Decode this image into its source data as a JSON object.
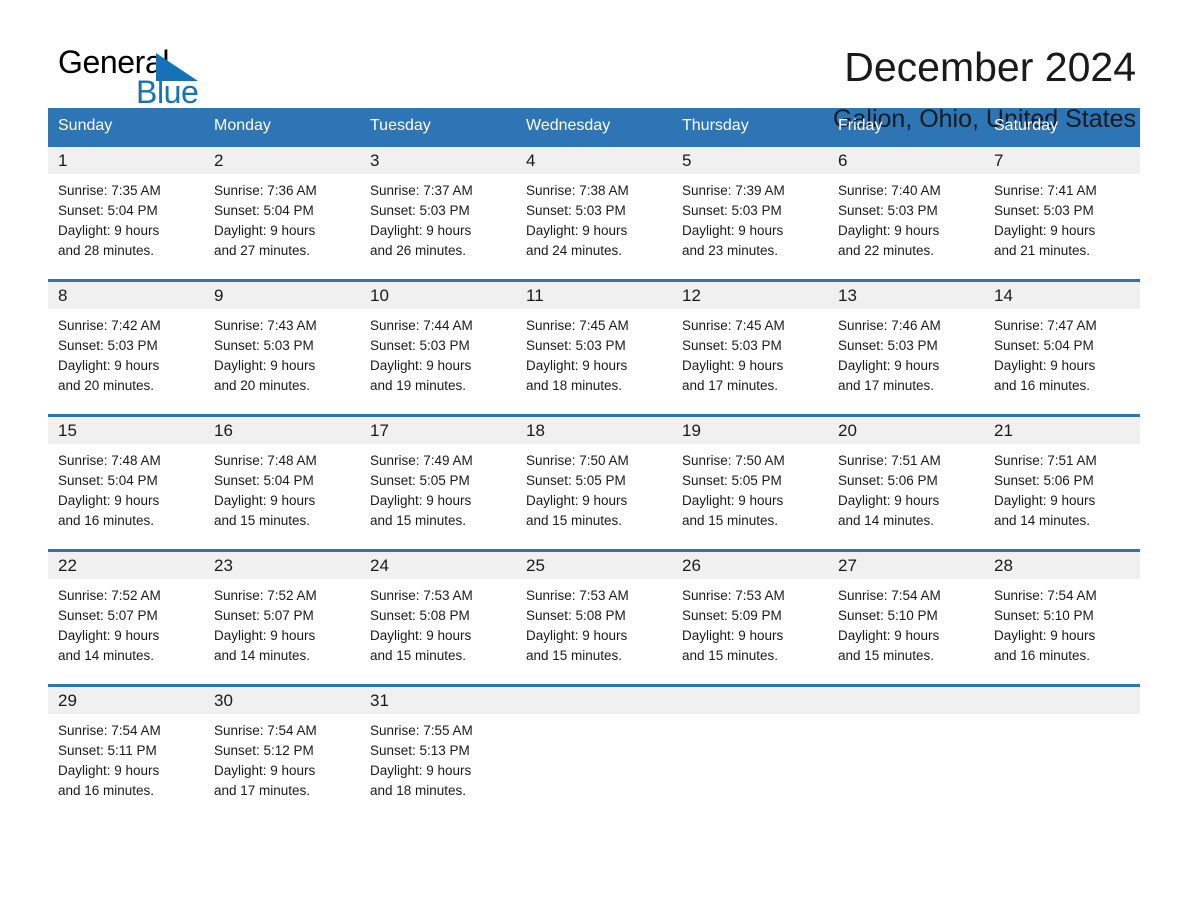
{
  "brand": {
    "name_part1": "General",
    "name_part2": "Blue",
    "triangle_icon": "blue-triangle-icon",
    "accent_color": "#1572b8"
  },
  "header": {
    "title": "December 2024",
    "location": "Galion, Ohio, United States",
    "header_bg_color": "#2e75b6",
    "daynum_bg_color": "#f0f0f0"
  },
  "weekday_headers": [
    "Sunday",
    "Monday",
    "Tuesday",
    "Wednesday",
    "Thursday",
    "Friday",
    "Saturday"
  ],
  "weeks": [
    [
      {
        "day": "1",
        "sunrise": "Sunrise: 7:35 AM",
        "sunset": "Sunset: 5:04 PM",
        "daylight_line1": "Daylight: 9 hours",
        "daylight_line2": "and 28 minutes."
      },
      {
        "day": "2",
        "sunrise": "Sunrise: 7:36 AM",
        "sunset": "Sunset: 5:04 PM",
        "daylight_line1": "Daylight: 9 hours",
        "daylight_line2": "and 27 minutes."
      },
      {
        "day": "3",
        "sunrise": "Sunrise: 7:37 AM",
        "sunset": "Sunset: 5:03 PM",
        "daylight_line1": "Daylight: 9 hours",
        "daylight_line2": "and 26 minutes."
      },
      {
        "day": "4",
        "sunrise": "Sunrise: 7:38 AM",
        "sunset": "Sunset: 5:03 PM",
        "daylight_line1": "Daylight: 9 hours",
        "daylight_line2": "and 24 minutes."
      },
      {
        "day": "5",
        "sunrise": "Sunrise: 7:39 AM",
        "sunset": "Sunset: 5:03 PM",
        "daylight_line1": "Daylight: 9 hours",
        "daylight_line2": "and 23 minutes."
      },
      {
        "day": "6",
        "sunrise": "Sunrise: 7:40 AM",
        "sunset": "Sunset: 5:03 PM",
        "daylight_line1": "Daylight: 9 hours",
        "daylight_line2": "and 22 minutes."
      },
      {
        "day": "7",
        "sunrise": "Sunrise: 7:41 AM",
        "sunset": "Sunset: 5:03 PM",
        "daylight_line1": "Daylight: 9 hours",
        "daylight_line2": "and 21 minutes."
      }
    ],
    [
      {
        "day": "8",
        "sunrise": "Sunrise: 7:42 AM",
        "sunset": "Sunset: 5:03 PM",
        "daylight_line1": "Daylight: 9 hours",
        "daylight_line2": "and 20 minutes."
      },
      {
        "day": "9",
        "sunrise": "Sunrise: 7:43 AM",
        "sunset": "Sunset: 5:03 PM",
        "daylight_line1": "Daylight: 9 hours",
        "daylight_line2": "and 20 minutes."
      },
      {
        "day": "10",
        "sunrise": "Sunrise: 7:44 AM",
        "sunset": "Sunset: 5:03 PM",
        "daylight_line1": "Daylight: 9 hours",
        "daylight_line2": "and 19 minutes."
      },
      {
        "day": "11",
        "sunrise": "Sunrise: 7:45 AM",
        "sunset": "Sunset: 5:03 PM",
        "daylight_line1": "Daylight: 9 hours",
        "daylight_line2": "and 18 minutes."
      },
      {
        "day": "12",
        "sunrise": "Sunrise: 7:45 AM",
        "sunset": "Sunset: 5:03 PM",
        "daylight_line1": "Daylight: 9 hours",
        "daylight_line2": "and 17 minutes."
      },
      {
        "day": "13",
        "sunrise": "Sunrise: 7:46 AM",
        "sunset": "Sunset: 5:03 PM",
        "daylight_line1": "Daylight: 9 hours",
        "daylight_line2": "and 17 minutes."
      },
      {
        "day": "14",
        "sunrise": "Sunrise: 7:47 AM",
        "sunset": "Sunset: 5:04 PM",
        "daylight_line1": "Daylight: 9 hours",
        "daylight_line2": "and 16 minutes."
      }
    ],
    [
      {
        "day": "15",
        "sunrise": "Sunrise: 7:48 AM",
        "sunset": "Sunset: 5:04 PM",
        "daylight_line1": "Daylight: 9 hours",
        "daylight_line2": "and 16 minutes."
      },
      {
        "day": "16",
        "sunrise": "Sunrise: 7:48 AM",
        "sunset": "Sunset: 5:04 PM",
        "daylight_line1": "Daylight: 9 hours",
        "daylight_line2": "and 15 minutes."
      },
      {
        "day": "17",
        "sunrise": "Sunrise: 7:49 AM",
        "sunset": "Sunset: 5:05 PM",
        "daylight_line1": "Daylight: 9 hours",
        "daylight_line2": "and 15 minutes."
      },
      {
        "day": "18",
        "sunrise": "Sunrise: 7:50 AM",
        "sunset": "Sunset: 5:05 PM",
        "daylight_line1": "Daylight: 9 hours",
        "daylight_line2": "and 15 minutes."
      },
      {
        "day": "19",
        "sunrise": "Sunrise: 7:50 AM",
        "sunset": "Sunset: 5:05 PM",
        "daylight_line1": "Daylight: 9 hours",
        "daylight_line2": "and 15 minutes."
      },
      {
        "day": "20",
        "sunrise": "Sunrise: 7:51 AM",
        "sunset": "Sunset: 5:06 PM",
        "daylight_line1": "Daylight: 9 hours",
        "daylight_line2": "and 14 minutes."
      },
      {
        "day": "21",
        "sunrise": "Sunrise: 7:51 AM",
        "sunset": "Sunset: 5:06 PM",
        "daylight_line1": "Daylight: 9 hours",
        "daylight_line2": "and 14 minutes."
      }
    ],
    [
      {
        "day": "22",
        "sunrise": "Sunrise: 7:52 AM",
        "sunset": "Sunset: 5:07 PM",
        "daylight_line1": "Daylight: 9 hours",
        "daylight_line2": "and 14 minutes."
      },
      {
        "day": "23",
        "sunrise": "Sunrise: 7:52 AM",
        "sunset": "Sunset: 5:07 PM",
        "daylight_line1": "Daylight: 9 hours",
        "daylight_line2": "and 14 minutes."
      },
      {
        "day": "24",
        "sunrise": "Sunrise: 7:53 AM",
        "sunset": "Sunset: 5:08 PM",
        "daylight_line1": "Daylight: 9 hours",
        "daylight_line2": "and 15 minutes."
      },
      {
        "day": "25",
        "sunrise": "Sunrise: 7:53 AM",
        "sunset": "Sunset: 5:08 PM",
        "daylight_line1": "Daylight: 9 hours",
        "daylight_line2": "and 15 minutes."
      },
      {
        "day": "26",
        "sunrise": "Sunrise: 7:53 AM",
        "sunset": "Sunset: 5:09 PM",
        "daylight_line1": "Daylight: 9 hours",
        "daylight_line2": "and 15 minutes."
      },
      {
        "day": "27",
        "sunrise": "Sunrise: 7:54 AM",
        "sunset": "Sunset: 5:10 PM",
        "daylight_line1": "Daylight: 9 hours",
        "daylight_line2": "and 15 minutes."
      },
      {
        "day": "28",
        "sunrise": "Sunrise: 7:54 AM",
        "sunset": "Sunset: 5:10 PM",
        "daylight_line1": "Daylight: 9 hours",
        "daylight_line2": "and 16 minutes."
      }
    ],
    [
      {
        "day": "29",
        "sunrise": "Sunrise: 7:54 AM",
        "sunset": "Sunset: 5:11 PM",
        "daylight_line1": "Daylight: 9 hours",
        "daylight_line2": "and 16 minutes."
      },
      {
        "day": "30",
        "sunrise": "Sunrise: 7:54 AM",
        "sunset": "Sunset: 5:12 PM",
        "daylight_line1": "Daylight: 9 hours",
        "daylight_line2": "and 17 minutes."
      },
      {
        "day": "31",
        "sunrise": "Sunrise: 7:55 AM",
        "sunset": "Sunset: 5:13 PM",
        "daylight_line1": "Daylight: 9 hours",
        "daylight_line2": "and 18 minutes."
      },
      {
        "day": "",
        "sunrise": "",
        "sunset": "",
        "daylight_line1": "",
        "daylight_line2": ""
      },
      {
        "day": "",
        "sunrise": "",
        "sunset": "",
        "daylight_line1": "",
        "daylight_line2": ""
      },
      {
        "day": "",
        "sunrise": "",
        "sunset": "",
        "daylight_line1": "",
        "daylight_line2": ""
      },
      {
        "day": "",
        "sunrise": "",
        "sunset": "",
        "daylight_line1": "",
        "daylight_line2": ""
      }
    ]
  ]
}
